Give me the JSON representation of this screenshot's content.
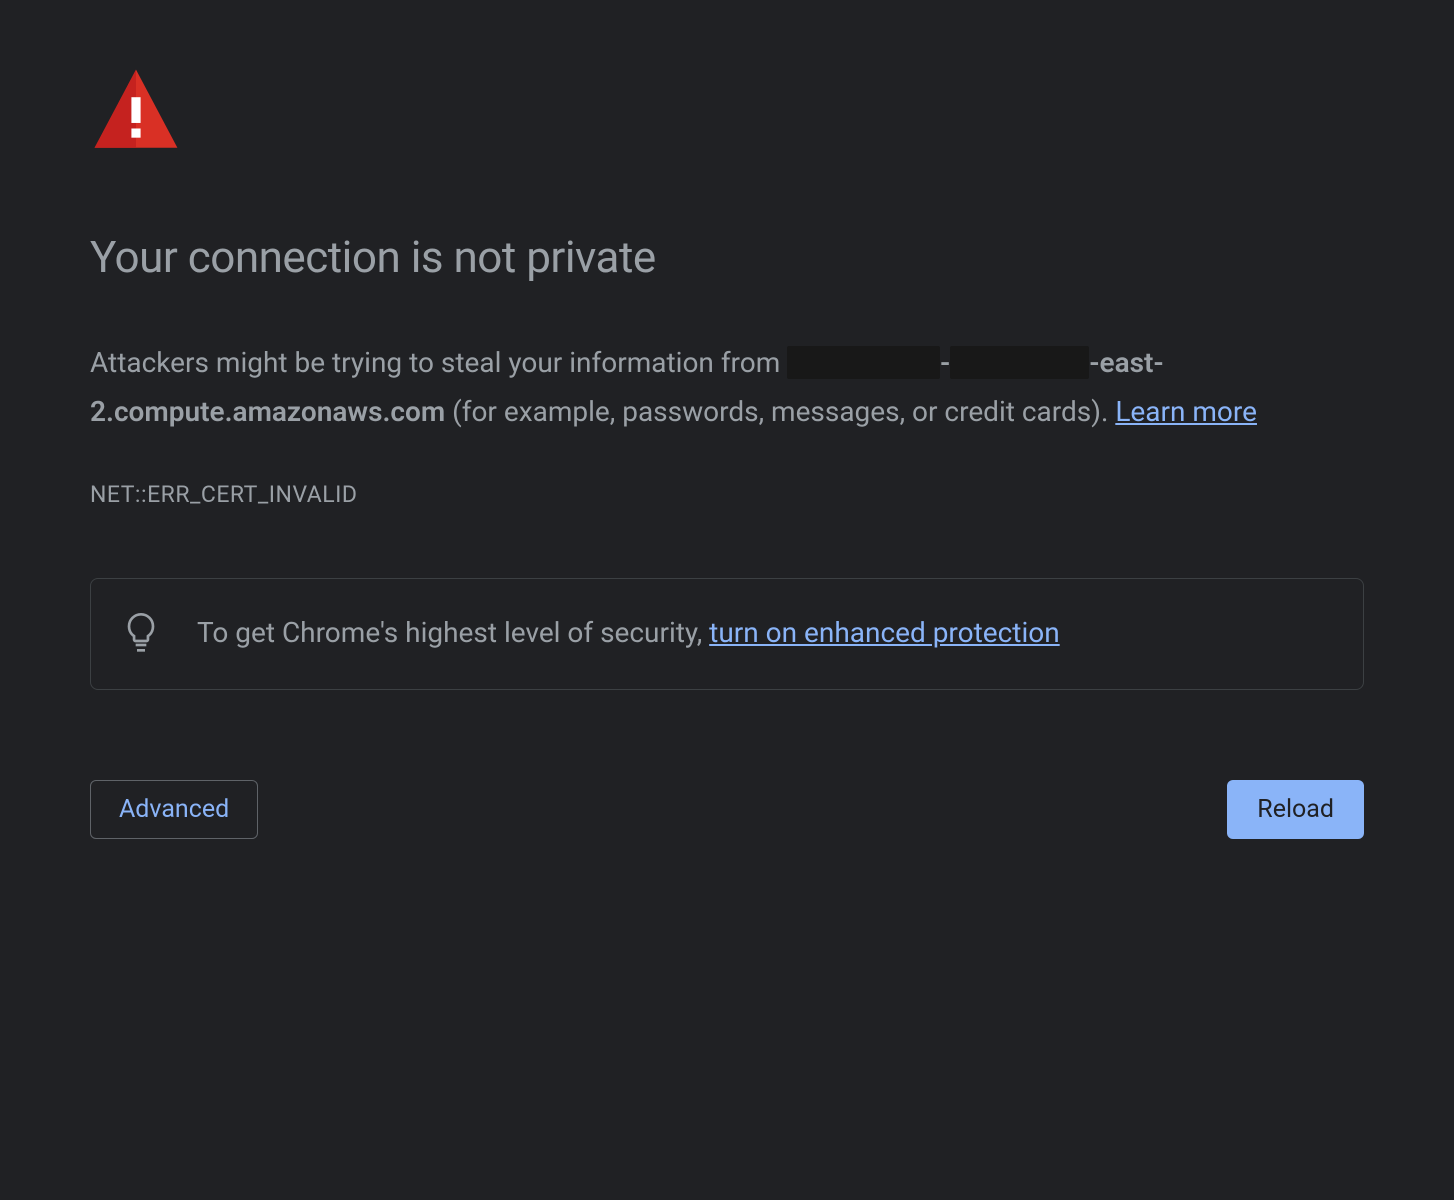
{
  "warning": {
    "title": "Your connection is not private",
    "description": {
      "prefix": "Attackers might be trying to steal your information from ",
      "redacted1": "xxxxxxxxxxx",
      "dash": "-",
      "redacted2": "xxxxxxxxxx",
      "hostname_suffix": "-east-2.compute.amazonaws.com",
      "suffix": " (for example, passwords, messages, or credit cards). ",
      "learn_more": "Learn more"
    },
    "error_code": "NET::ERR_CERT_INVALID"
  },
  "tip": {
    "text_prefix": "To get Chrome's highest level of security, ",
    "link_text": "turn on enhanced protection"
  },
  "buttons": {
    "advanced": "Advanced",
    "reload": "Reload"
  },
  "colors": {
    "background": "#202124",
    "text": "#9aa0a6",
    "link": "#8ab4f8",
    "warning_icon": "#d93025",
    "button_primary_bg": "#8ab4f8",
    "button_primary_text": "#202124",
    "border": "#3c4043"
  }
}
